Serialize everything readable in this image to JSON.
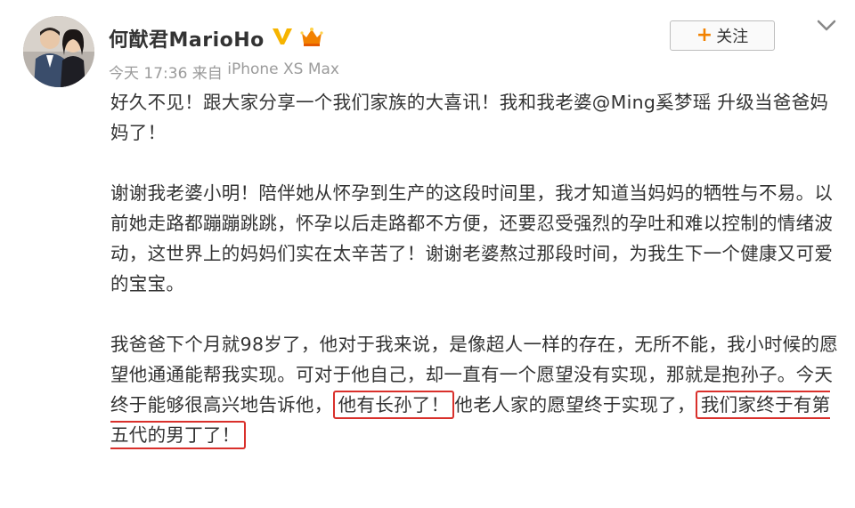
{
  "post": {
    "username": "何猷君MarioHo",
    "time": "今天 17:36",
    "source_prefix": " 来自 ",
    "source_device": "iPhone XS Max",
    "follow_label": "关注",
    "follow_plus": "+",
    "paragraphs": {
      "p1": "好久不见！跟大家分享一个我们家族的大喜讯！我和我老婆@Ming奚梦瑶 升级当爸爸妈妈了！",
      "p2": "谢谢我老婆小明！陪伴她从怀孕到生产的这段时间里，我才知道当妈妈的牺牲与不易。以前她走路都蹦蹦跳跳，怀孕以后走路都不方便，还要忍受强烈的孕吐和难以控制的情绪波动，这世界上的妈妈们实在太辛苦了！谢谢老婆熬过那段时间，为我生下一个健康又可爱的宝宝。",
      "p3_a": "我爸爸下个月就98岁了，他对于我来说，是像超人一样的存在，无所不能，我小时候的愿望他通通能帮我实现。可对于他自己，却一直有一个愿望没有实现，那就是抱孙子。今天终于能够很高兴地告诉他，",
      "p3_highlight1": "他有长孙了！",
      "p3_b": "他老人家的愿望终于实现了，",
      "p3_highlight2": "我们家终于有第五代的男丁了！"
    },
    "colors": {
      "vip_badge": "#f6b400",
      "follow_plus": "#f28100",
      "highlight_border": "#d9302b",
      "meta_text": "#9b9b9b"
    }
  }
}
